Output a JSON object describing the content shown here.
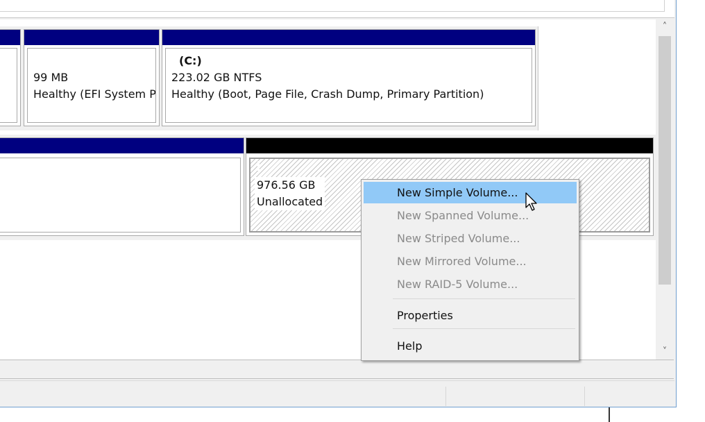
{
  "disk0": {
    "efi_partition": {
      "size": "99 MB",
      "status": "Healthy (EFI System Pa"
    },
    "c_partition": {
      "label": "(C:)",
      "size_fs": "223.02 GB NTFS",
      "status": "Healthy (Boot, Page File, Crash Dump, Primary Partition)"
    }
  },
  "disk1": {
    "unallocated": {
      "size": "976.56 GB",
      "status": "Unallocated"
    }
  },
  "context_menu": {
    "items": [
      {
        "label": "New Simple Volume...",
        "enabled": true,
        "highlighted": true
      },
      {
        "label": "New Spanned Volume...",
        "enabled": false
      },
      {
        "label": "New Striped Volume...",
        "enabled": false
      },
      {
        "label": "New Mirrored Volume...",
        "enabled": false
      },
      {
        "label": "New RAID-5 Volume...",
        "enabled": false
      },
      {
        "label": "Properties",
        "enabled": true
      },
      {
        "label": "Help",
        "enabled": true
      }
    ]
  },
  "scrollbar": {
    "up_glyph": "˄",
    "down_glyph": "˅"
  },
  "colors": {
    "primary_partition_bar": "#000080",
    "unallocated_bar": "#000000",
    "menu_highlight": "#91c9f7",
    "disabled_text": "#8a8a8a"
  },
  "icons": {
    "cursor": "arrow-pointer-icon",
    "scroll_up": "chevron-up-icon",
    "scroll_down": "chevron-down-icon"
  }
}
